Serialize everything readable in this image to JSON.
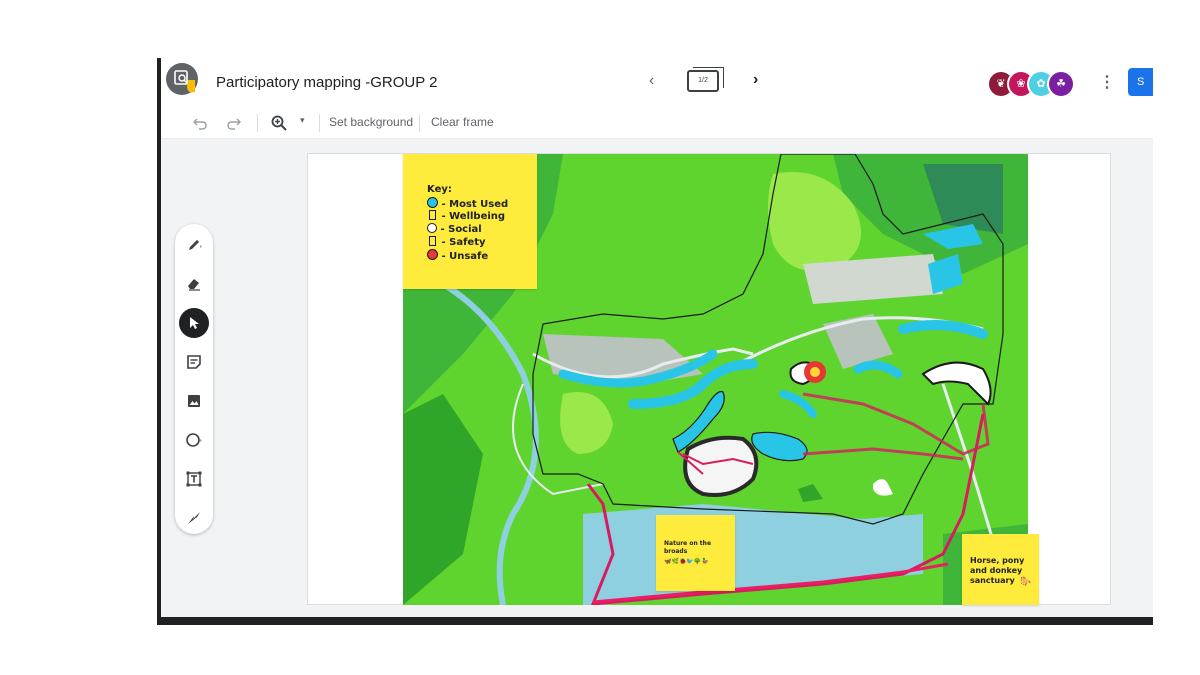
{
  "app": {
    "title": "Participatory mapping -GROUP 2",
    "frame_indicator": "1/2",
    "share_label": "S"
  },
  "toolbar": {
    "undo_icon": "undo-icon",
    "redo_icon": "redo-icon",
    "zoom_icon": "zoom-in-icon",
    "zoom_dropdown_icon": "caret-down-icon",
    "set_background": "Set background",
    "clear_frame": "Clear frame"
  },
  "tools": [
    {
      "name": "pen-tool",
      "icon": "pen-icon"
    },
    {
      "name": "eraser-tool",
      "icon": "eraser-icon"
    },
    {
      "name": "select-tool",
      "icon": "cursor-icon",
      "active": true
    },
    {
      "name": "sticky-note-tool",
      "icon": "sticky-note-icon"
    },
    {
      "name": "image-tool",
      "icon": "image-icon"
    },
    {
      "name": "shape-tool",
      "icon": "circle-icon"
    },
    {
      "name": "text-box-tool",
      "icon": "text-box-icon"
    },
    {
      "name": "laser-tool",
      "icon": "laser-icon"
    }
  ],
  "key_note": {
    "title": "Key:",
    "items": [
      {
        "label": " - Most Used",
        "color": "#29c5e6"
      },
      {
        "label": " - Wellbeing",
        "color": "#ffffff"
      },
      {
        "label": " - Social",
        "color": "#ffffff"
      },
      {
        "label": " - Safety",
        "color": "#ffffff"
      },
      {
        "label": " - Unsafe",
        "color": "#e53935"
      }
    ]
  },
  "nature_note": {
    "text": "Nature on the broads"
  },
  "horse_note": {
    "text": "Horse, pony and donkey sanctuary"
  },
  "colors": {
    "map_green": "#5fd42e",
    "dark_green": "#2fa52a",
    "water": "#8fd0e0",
    "most_used": "#29c5e6",
    "unsafe": "#e53935",
    "route": "#d81b60",
    "sticky": "#ffeb3b",
    "share_blue": "#1a73e8"
  }
}
